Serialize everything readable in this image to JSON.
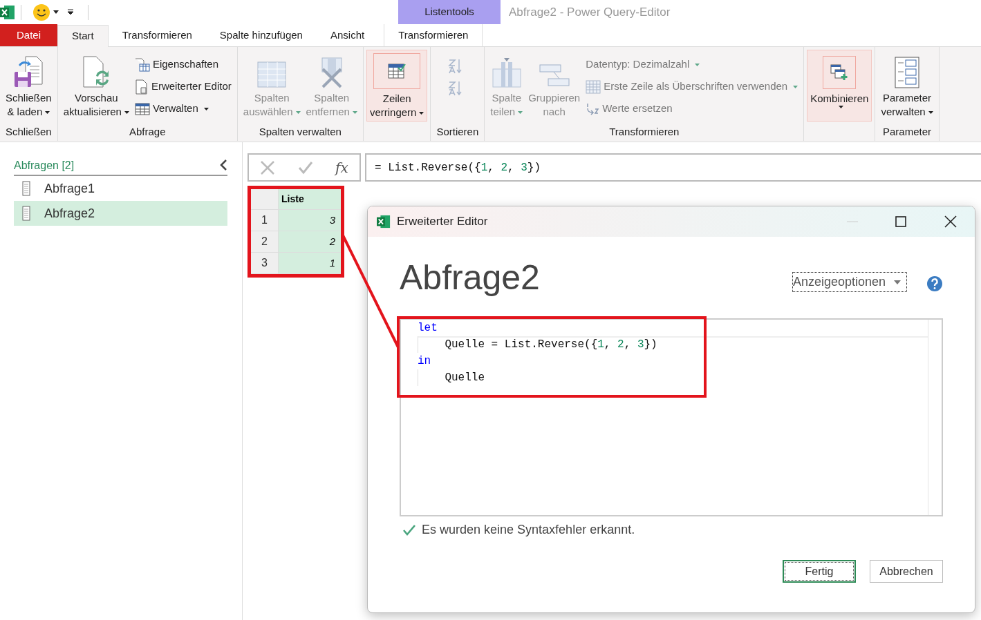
{
  "title_bar": {
    "contextual_group": "Listentools",
    "title": "Abfrage2 - Power Query-Editor"
  },
  "tabs": [
    {
      "label": "Datei",
      "kind": "file",
      "selected": false
    },
    {
      "label": "Start",
      "kind": "normal",
      "selected": true
    },
    {
      "label": "Transformieren",
      "kind": "normal",
      "selected": false
    },
    {
      "label": "Spalte hinzufügen",
      "kind": "normal",
      "selected": false
    },
    {
      "label": "Ansicht",
      "kind": "normal",
      "selected": false
    },
    {
      "label": "Transformieren",
      "kind": "contextual",
      "selected": false
    }
  ],
  "ribbon": {
    "groups": [
      {
        "label": "Schließen",
        "items": [
          {
            "kind": "large",
            "lines": [
              "Schließen",
              "& laden"
            ],
            "dropdown": true,
            "disabled": false,
            "highlighted": false
          }
        ]
      },
      {
        "label": "Abfrage",
        "items": [
          {
            "kind": "large",
            "lines": [
              "Vorschau",
              "aktualisieren"
            ],
            "dropdown": true,
            "disabled": false,
            "highlighted": false
          },
          {
            "kind": "stack",
            "children": [
              {
                "label": "Eigenschaften",
                "dropdown": false,
                "disabled": false
              },
              {
                "label": "Erweiterter Editor",
                "dropdown": false,
                "disabled": false
              },
              {
                "label": "Verwalten",
                "dropdown": true,
                "disabled": false
              }
            ]
          }
        ]
      },
      {
        "label": "Spalten verwalten",
        "items": [
          {
            "kind": "large",
            "lines": [
              "Spalten",
              "auswählen"
            ],
            "dropdown": true,
            "disabled": true,
            "highlighted": false
          },
          {
            "kind": "large",
            "lines": [
              "Spalten",
              "entfernen"
            ],
            "dropdown": true,
            "disabled": true,
            "highlighted": false
          }
        ]
      },
      {
        "items": [
          {
            "kind": "large",
            "lines": [
              "Zeilen",
              "verringern"
            ],
            "dropdown": true,
            "disabled": false,
            "highlighted": true
          }
        ]
      },
      {
        "label": "Sortieren",
        "items": [
          {
            "kind": "sort",
            "disabled": true
          }
        ]
      },
      {
        "label": "Transformieren",
        "items": [
          {
            "kind": "large",
            "lines": [
              "Spalte",
              "teilen"
            ],
            "dropdown": true,
            "disabled": true,
            "highlighted": false
          },
          {
            "kind": "large",
            "lines": [
              "Gruppieren",
              "nach"
            ],
            "dropdown": false,
            "disabled": true,
            "highlighted": false
          },
          {
            "kind": "stack",
            "children": [
              {
                "label": "Datentyp: Dezimalzahl",
                "dropdown": true,
                "disabled": true
              },
              {
                "label": "Erste Zeile als Überschriften verwenden",
                "dropdown": true,
                "disabled": true
              },
              {
                "label": "Werte ersetzen",
                "dropdown": false,
                "disabled": true
              }
            ]
          }
        ]
      },
      {
        "items": [
          {
            "kind": "large",
            "lines": [
              "Kombinieren"
            ],
            "dropdown": true,
            "disabled": false,
            "highlighted": true
          }
        ]
      },
      {
        "label": "Parameter",
        "items": [
          {
            "kind": "large",
            "lines": [
              "Parameter",
              "verwalten"
            ],
            "dropdown": true,
            "disabled": false,
            "highlighted": false
          }
        ]
      }
    ]
  },
  "queries": {
    "header": "Abfragen [2]",
    "items": [
      {
        "name": "Abfrage1",
        "selected": false
      },
      {
        "name": "Abfrage2",
        "selected": true
      }
    ]
  },
  "formula": {
    "function_label": "fx",
    "tokens": [
      {
        "kind": "text",
        "text": "= List.Reverse({"
      },
      {
        "kind": "number",
        "text": "1"
      },
      {
        "kind": "text",
        "text": ", "
      },
      {
        "kind": "number",
        "text": "2"
      },
      {
        "kind": "text",
        "text": ", "
      },
      {
        "kind": "number",
        "text": "3"
      },
      {
        "kind": "text",
        "text": "})"
      }
    ]
  },
  "table": {
    "column": {
      "name": "Liste",
      "selected": true
    },
    "rows": [
      {
        "index": "1",
        "value": "3"
      },
      {
        "index": "2",
        "value": "2"
      },
      {
        "index": "3",
        "value": "1"
      }
    ]
  },
  "dialog": {
    "title": "Erweiterter Editor",
    "heading": "Abfrage2",
    "display_options": "Anzeigeoptionen",
    "code_lines": [
      {
        "guide": false,
        "tokens": [
          {
            "kind": "keyword",
            "text": "let"
          }
        ]
      },
      {
        "guide": true,
        "tokens": [
          {
            "kind": "text",
            "text": "    Quelle = List.Reverse({"
          },
          {
            "kind": "number",
            "text": "1"
          },
          {
            "kind": "text",
            "text": ", "
          },
          {
            "kind": "number",
            "text": "2"
          },
          {
            "kind": "text",
            "text": ", "
          },
          {
            "kind": "number",
            "text": "3"
          },
          {
            "kind": "text",
            "text": "})"
          }
        ]
      },
      {
        "guide": false,
        "tokens": [
          {
            "kind": "keyword",
            "text": "in"
          }
        ]
      },
      {
        "guide": true,
        "tokens": [
          {
            "kind": "text",
            "text": "    Quelle"
          }
        ]
      }
    ],
    "status": "Es wurden keine Syntaxfehler erkannt.",
    "buttons": [
      {
        "label": "Fertig",
        "primary": true
      },
      {
        "label": "Abbrechen",
        "primary": false
      }
    ]
  }
}
